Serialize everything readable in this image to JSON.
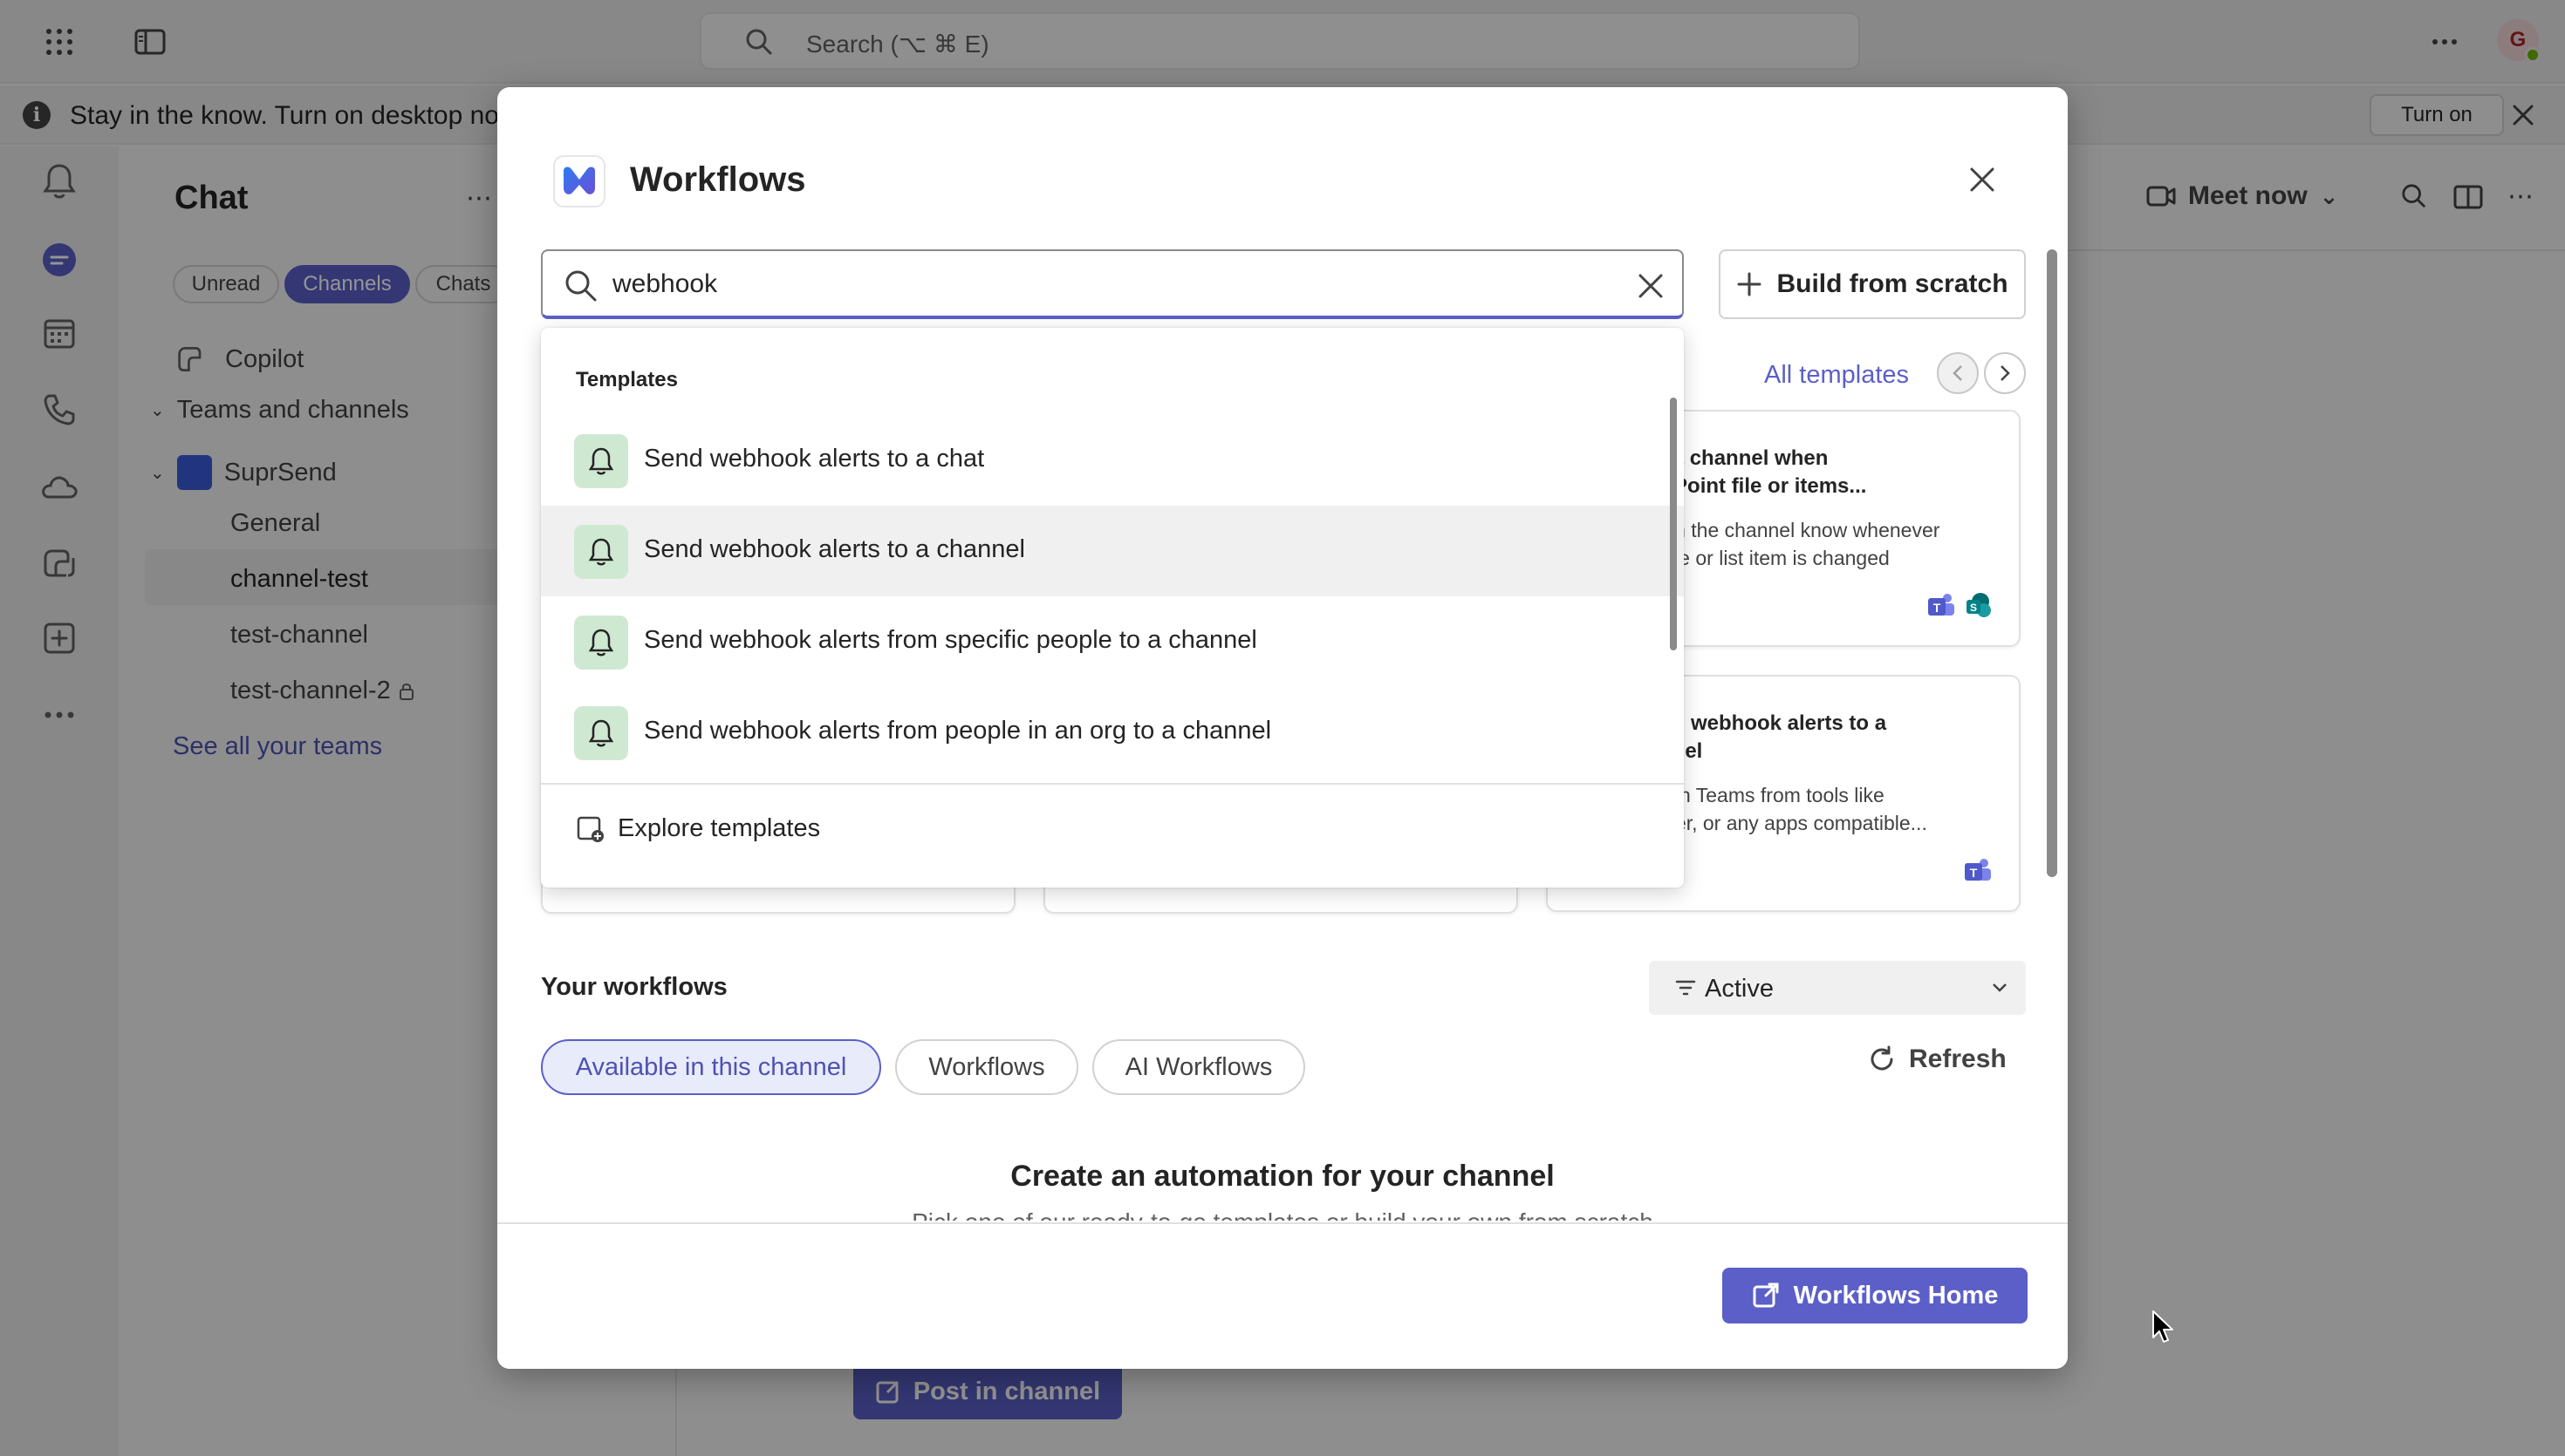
{
  "topbar": {
    "search_placeholder": "Search (⌥ ⌘ E)",
    "avatar_initial": "G"
  },
  "banner": {
    "text": "Stay in the know. Turn on desktop noti",
    "turn_on_label": "Turn on"
  },
  "chatlist": {
    "title": "Chat",
    "filters": [
      "Unread",
      "Channels",
      "Chats"
    ],
    "copilot": "Copilot",
    "section": "Teams and channels",
    "team_name": "SuprSend",
    "channels": [
      "General",
      "channel-test",
      "test-channel",
      "test-channel-2"
    ],
    "see_all": "See all your teams"
  },
  "main": {
    "meet_now": "Meet now",
    "post_in_channel": "Post in channel"
  },
  "dialog": {
    "title": "Workflows",
    "search_value": "webhook",
    "build_label": "Build from scratch",
    "all_templates": "All templates",
    "cards": [
      {
        "title": "ify a channel when\narePoint file or items...",
        "desc": "ne in the channel know whenever\nnt file or list item is changed"
      },
      {
        "title": "nd webhook alerts to a\nnnel",
        "desc": "s in Teams from tools like\npier, or any apps compatible..."
      }
    ],
    "your_workflows": "Your workflows",
    "filter_value": "Active",
    "tabs": [
      "Available in this channel",
      "Workflows",
      "AI Workflows"
    ],
    "refresh_label": "Refresh",
    "empty_title": "Create an automation for your channel",
    "empty_sub": "Pick one of our ready-to-go templates or build your own from scratch",
    "workflows_home": "Workflows Home"
  },
  "dropdown": {
    "header": "Templates",
    "items": [
      "Send webhook alerts to a chat",
      "Send webhook alerts to a channel",
      "Send webhook alerts from specific people to a channel",
      "Send webhook alerts from people in an org to a channel"
    ],
    "explore": "Explore templates"
  },
  "colors": {
    "accent": "#5b5fc7",
    "bell_bg": "#cfe8d2"
  }
}
